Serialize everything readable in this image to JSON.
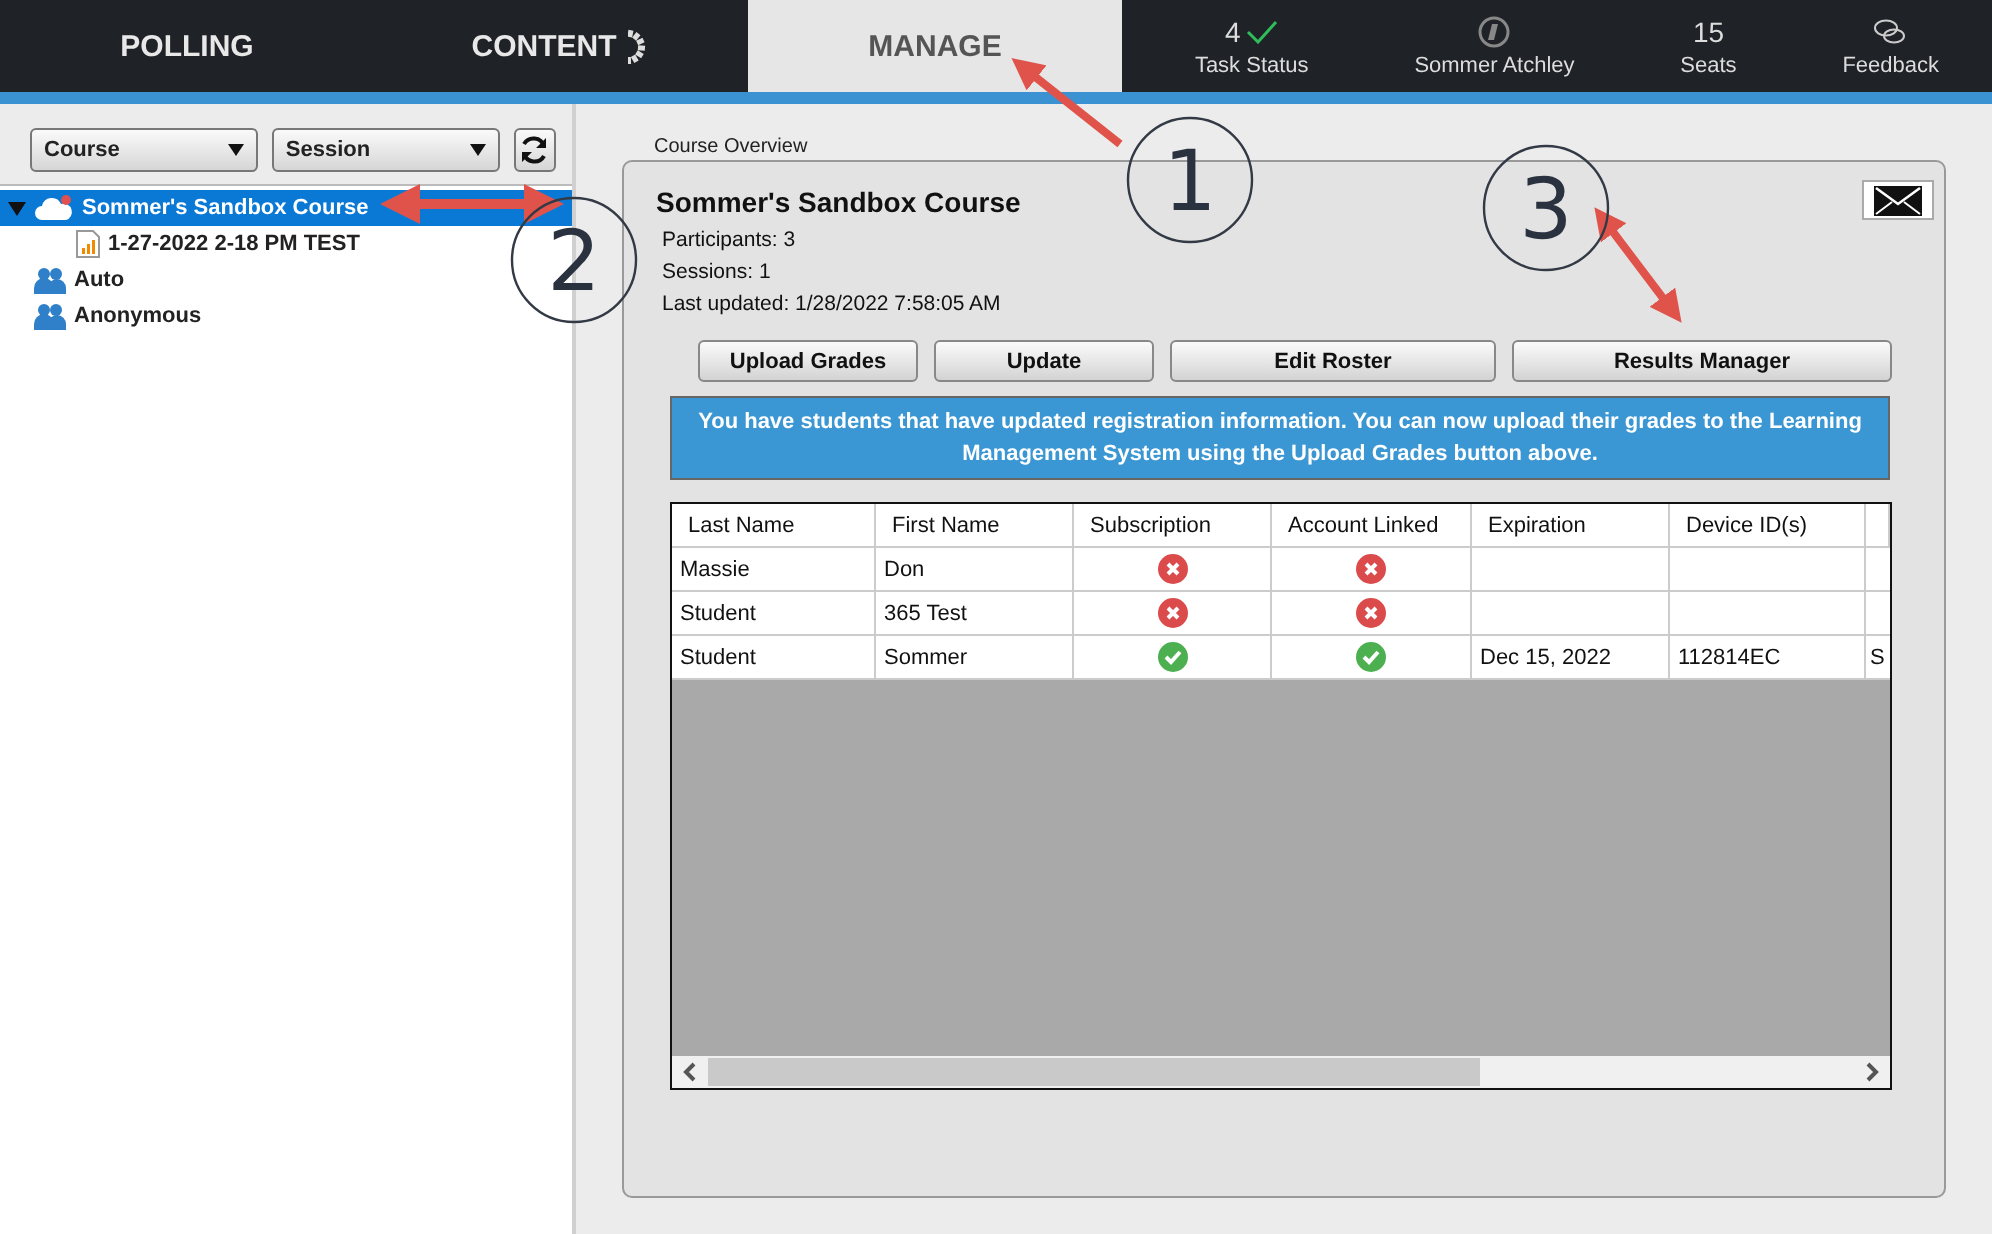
{
  "nav_tabs": [
    {
      "label": "POLLING",
      "selected": false,
      "spinner": false
    },
    {
      "label": "CONTENT",
      "selected": false,
      "spinner": true
    },
    {
      "label": "MANAGE",
      "selected": true,
      "spinner": false
    }
  ],
  "status_items": [
    {
      "kind": "task",
      "value": "4",
      "label": "Task Status"
    },
    {
      "kind": "user",
      "label": "Sommer Atchley"
    },
    {
      "kind": "count",
      "value": "15",
      "label": "Seats"
    },
    {
      "kind": "feedback",
      "label": "Feedback"
    }
  ],
  "sidebar": {
    "dropdowns": [
      {
        "value": "Course"
      },
      {
        "value": "Session"
      }
    ],
    "tree": [
      {
        "label": "Sommer's Sandbox Course",
        "kind": "course",
        "selected": true,
        "expanded": true,
        "children": [
          {
            "label": "1-27-2022 2-18 PM TEST",
            "kind": "session",
            "selected": false
          }
        ]
      },
      {
        "label": "Auto",
        "kind": "group",
        "selected": false
      },
      {
        "label": "Anonymous",
        "kind": "group",
        "selected": false
      }
    ]
  },
  "overview": {
    "group_label": "Course Overview",
    "title": "Sommer's Sandbox Course",
    "details": [
      "Participants: 3",
      "Sessions: 1",
      "Last updated: 1/28/2022 7:58:05 AM"
    ],
    "buttons": [
      "Upload Grades",
      "Update",
      "Edit Roster",
      "Results Manager"
    ],
    "notice": "You have students that have updated registration information. You can now upload their grades to the Learning Management System using the Upload Grades button above.",
    "table": {
      "columns": [
        "Last Name",
        "First Name",
        "Subscription",
        "Account Linked",
        "Expiration",
        "Device ID(s)"
      ],
      "rows": [
        {
          "last_name": "Massie",
          "first_name": "Don",
          "subscription": false,
          "account_linked": false
        },
        {
          "last_name": "Student",
          "first_name": "365 Test",
          "subscription": false,
          "account_linked": false
        },
        {
          "last_name": "Student",
          "first_name": "Sommer",
          "subscription": true,
          "account_linked": true,
          "expiration": "Dec 15, 2022",
          "device_ids": "112814EC",
          "column_7": "S"
        }
      ]
    }
  },
  "annotations": [
    {
      "number": "1"
    },
    {
      "number": "2"
    },
    {
      "number": "3"
    }
  ]
}
